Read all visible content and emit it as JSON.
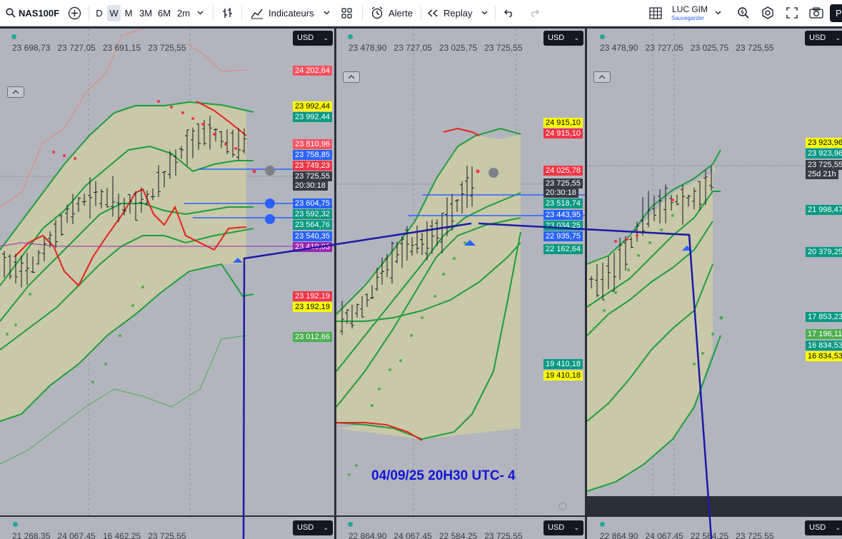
{
  "toolbar": {
    "symbol": "NAS100F",
    "timeframes": [
      "D",
      "W",
      "M",
      "3M",
      "6M",
      "2m"
    ],
    "active_timeframe": "W",
    "indicators_label": "Indicateurs",
    "alert_label": "Alerte",
    "replay_label": "Replay",
    "user_name": "LUC GIM",
    "save_label": "Sauvegarder",
    "publish_initial": "P"
  },
  "panels": [
    {
      "ohlc": [
        "23 698,73",
        "23 727,05",
        "23 691,15",
        "23 725,55"
      ],
      "currency": "USD",
      "labels": [
        {
          "text": "24 202,64",
          "color": "pink"
        },
        {
          "text": "23 992,44",
          "color": "yellow"
        },
        {
          "text": "23 992,44",
          "color": "green"
        },
        {
          "text": "23 810,96",
          "color": "pink"
        },
        {
          "text": "23 758,85",
          "color": "blue"
        },
        {
          "text": "23 749,23",
          "color": "red"
        },
        {
          "text": "23 725,55",
          "color": "dark"
        },
        {
          "text": "20:30:18",
          "color": "dark"
        },
        {
          "text": "23 604,75",
          "color": "blue"
        },
        {
          "text": "23 592,32",
          "color": "green"
        },
        {
          "text": "23 564,76",
          "color": "green"
        },
        {
          "text": "23 540,35",
          "color": "blue"
        },
        {
          "text": "23 419,03",
          "color": "purple"
        },
        {
          "text": "23 192,19",
          "color": "red"
        },
        {
          "text": "23 192,19",
          "color": "yellow"
        },
        {
          "text": "23 012,66",
          "color": "lightgreen"
        }
      ]
    },
    {
      "ohlc": [
        "23 478,90",
        "23 727,05",
        "23 025,75",
        "23 725,55"
      ],
      "currency": "USD",
      "labels": [
        {
          "text": "24 915,10",
          "color": "yellow"
        },
        {
          "text": "24 915,10",
          "color": "red"
        },
        {
          "text": "24 025,78",
          "color": "red"
        },
        {
          "text": "23 725,55",
          "color": "dark"
        },
        {
          "text": "20:30:18",
          "color": "dark"
        },
        {
          "text": "23 518,74",
          "color": "green"
        },
        {
          "text": "23 443,95",
          "color": "blue"
        },
        {
          "text": "23 034,25",
          "color": "green"
        },
        {
          "text": "22 935,75",
          "color": "blue"
        },
        {
          "text": "22 162,64",
          "color": "green"
        },
        {
          "text": "19 410,18",
          "color": "green"
        },
        {
          "text": "19 410,18",
          "color": "yellow"
        }
      ]
    },
    {
      "ohlc": [
        "23 478,90",
        "23 727,05",
        "23 025,75",
        "23 725,55"
      ],
      "currency": "USD",
      "labels": [
        {
          "text": "23 923,96",
          "color": "yellow"
        },
        {
          "text": "23 923,96",
          "color": "green"
        },
        {
          "text": "23 725,55",
          "color": "dark"
        },
        {
          "text": "25d 21h",
          "color": "dark"
        },
        {
          "text": "21 998,47",
          "color": "green"
        },
        {
          "text": "20 379,25",
          "color": "green"
        },
        {
          "text": "17 853,23",
          "color": "green"
        },
        {
          "text": "17 196,11",
          "color": "lightgreen"
        },
        {
          "text": "16 834,53",
          "color": "green"
        },
        {
          "text": "16 834,53",
          "color": "yellow"
        }
      ]
    }
  ],
  "annotation": "04/09/25 20H30 UTC- 4",
  "bottom_panels": [
    {
      "ohlc": [
        "21 268,35",
        "24 067,45",
        "16 462,25",
        "23 725,55"
      ],
      "currency": "USD"
    },
    {
      "ohlc": [
        "22 864,90",
        "24 067,45",
        "22 584,25",
        "23 725,55"
      ],
      "currency": "USD"
    },
    {
      "ohlc": [
        "22 864,90",
        "24 067,45",
        "22 584,25",
        "23 725,55"
      ],
      "currency": "USD"
    }
  ],
  "colors": {
    "panel_bg": "#b2b5be",
    "band_fill": "#c9c8a8",
    "band_green": "#1e9e3a",
    "line_red": "#e8231b",
    "annotation_blue": "#1414d6",
    "accent_blue": "#2962ff"
  },
  "icons": [
    "search-icon",
    "add-symbol-icon",
    "chevron-down-icon",
    "bar-style-icon",
    "indicators-icon",
    "layout-grid-icon",
    "alert-clock-icon",
    "replay-icon",
    "undo-icon",
    "redo-icon",
    "chart-layout-icon",
    "quick-search-icon",
    "settings-gear-icon",
    "fullscreen-icon",
    "camera-icon"
  ]
}
